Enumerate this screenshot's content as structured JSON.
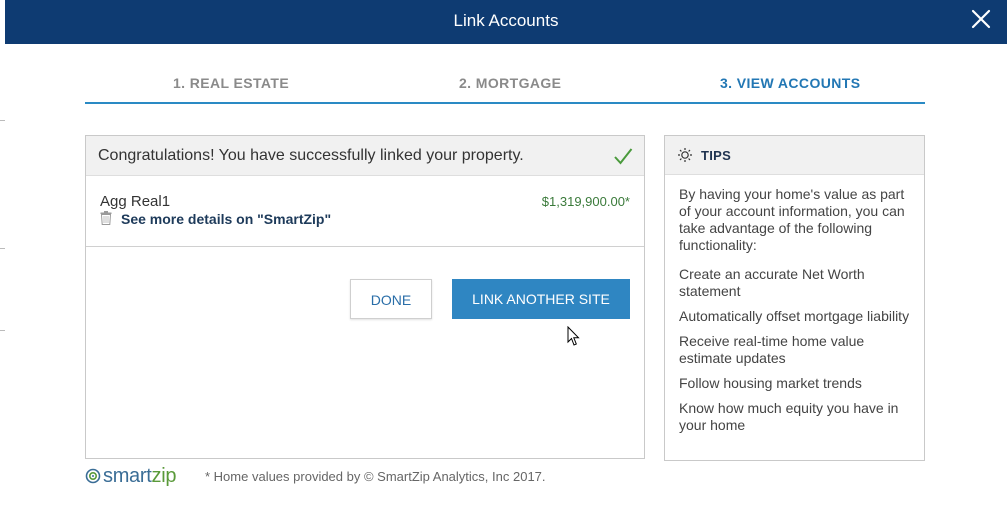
{
  "window": {
    "title": "Link Accounts",
    "close_icon": "close-icon",
    "header_color": "#0e3b72"
  },
  "steps": [
    {
      "label": "1. REAL ESTATE",
      "active": false
    },
    {
      "label": "2. MORTGAGE",
      "active": false
    },
    {
      "label": "3. VIEW ACCOUNTS",
      "active": true
    }
  ],
  "accent_color": "#2a8ac4",
  "result": {
    "message": "Congratulations! You have successfully linked your property.",
    "status_icon": "checkmark-icon"
  },
  "account": {
    "name": "Agg Real1",
    "value": "$1,319,900.00*",
    "details_link": "See more details on \"SmartZip\"",
    "delete_icon": "trash-icon"
  },
  "actions": {
    "done_label": "DONE",
    "link_another_label": "LINK ANOTHER SITE"
  },
  "tips": {
    "title": "TIPS",
    "icon": "lightbulb-icon",
    "intro": "By having your home's value as part of your account information, you can take advantage of the following functionality:",
    "items": [
      "Create an accurate Net Worth statement",
      "Automatically offset mortgage liability",
      "Receive real-time home value estimate updates",
      "Follow housing market trends",
      "Know how much equity you have in your home"
    ]
  },
  "footer": {
    "logo_smart": "smart",
    "logo_zip": "zip",
    "note": "* Home values provided by © SmartZip Analytics, Inc 2017."
  }
}
